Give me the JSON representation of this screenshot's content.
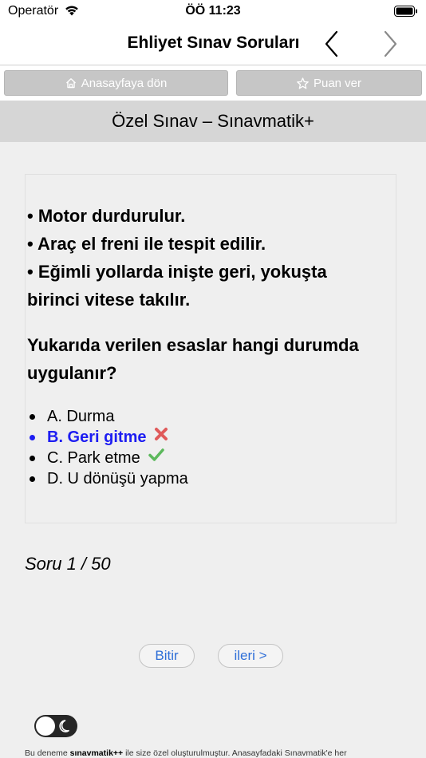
{
  "status": {
    "carrier": "Operatör",
    "time": "ÖÖ 11:23"
  },
  "nav": {
    "title": "Ehliyet Sınav Soruları"
  },
  "toolbar": {
    "home_label": "Anasayfaya dön",
    "rate_label": "Puan ver"
  },
  "exam": {
    "title": "Özel Sınav – Sınavmatik+"
  },
  "question": {
    "statements": [
      "• Motor durdurulur.",
      "• Araç el freni ile tespit edilir.",
      "• Eğimli yollarda inişte geri, yokuşta birinci vitese takılır."
    ],
    "prompt": "Yukarıda verilen esaslar hangi durumda uygulanır?",
    "options": [
      {
        "label": "A. Durma",
        "state": "none"
      },
      {
        "label": "B. Geri gitme",
        "state": "wrong-selected"
      },
      {
        "label": "C. Park etme",
        "state": "correct"
      },
      {
        "label": "D. U dönüşü yapma",
        "state": "none"
      }
    ]
  },
  "progress": {
    "counter": "Soru 1 / 50"
  },
  "actions": {
    "finish_label": "Bitir",
    "next_label": "ileri >"
  },
  "footer": {
    "prefix": "Bu deneme ",
    "brand": "sınavmatik++",
    "suffix": " ile size özel oluşturulmuştur. Anasayfadaki Sınavmatik'e her"
  },
  "colors": {
    "selected": "#1d1df2",
    "correct": "#5cb85c",
    "wrong": "#e05a5a",
    "link": "#2f6fd8"
  },
  "icons": {
    "back": "chevron-left-icon",
    "forward": "chevron-right-icon",
    "home": "home-icon",
    "star": "star-icon",
    "wrong": "cross-icon",
    "correct": "checkmark-icon",
    "moon": "moon-icon"
  }
}
